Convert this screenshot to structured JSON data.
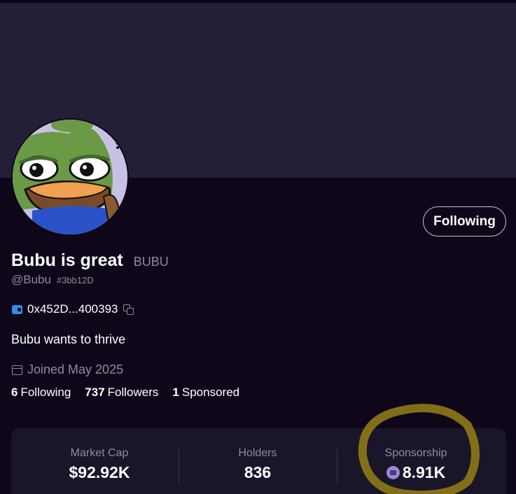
{
  "profile": {
    "name": "Bubu is great",
    "ticker": "BUBU",
    "handle": "@Bubu",
    "hex_id": "#3bb12D",
    "wallet": "0x452D...400393",
    "bio": "Bubu wants to thrive",
    "joined": "Joined May 2025"
  },
  "actions": {
    "follow_label": "Following"
  },
  "counts": {
    "following_num": "6",
    "following_label": "Following",
    "followers_num": "737",
    "followers_label": "Followers",
    "sponsored_num": "1",
    "sponsored_label": "Sponsored"
  },
  "metrics": {
    "market_cap_label": "Market Cap",
    "market_cap_value": "$92.92K",
    "holders_label": "Holders",
    "holders_value": "836",
    "sponsorship_label": "Sponsorship",
    "sponsorship_value": "8.91K"
  },
  "icons": {
    "avatar": "pepe-frog-avatar",
    "wallet": "wallet-icon",
    "copy": "copy-icon",
    "calendar": "calendar-icon",
    "sponsorship": "sponsorship-token-icon"
  },
  "colors": {
    "background": "#0d0719",
    "banner": "#241f37",
    "card": "#1a1629",
    "muted_text": "#8f8a9f",
    "wallet_accent": "#2f8ee6",
    "annotation": "#8a7418"
  }
}
